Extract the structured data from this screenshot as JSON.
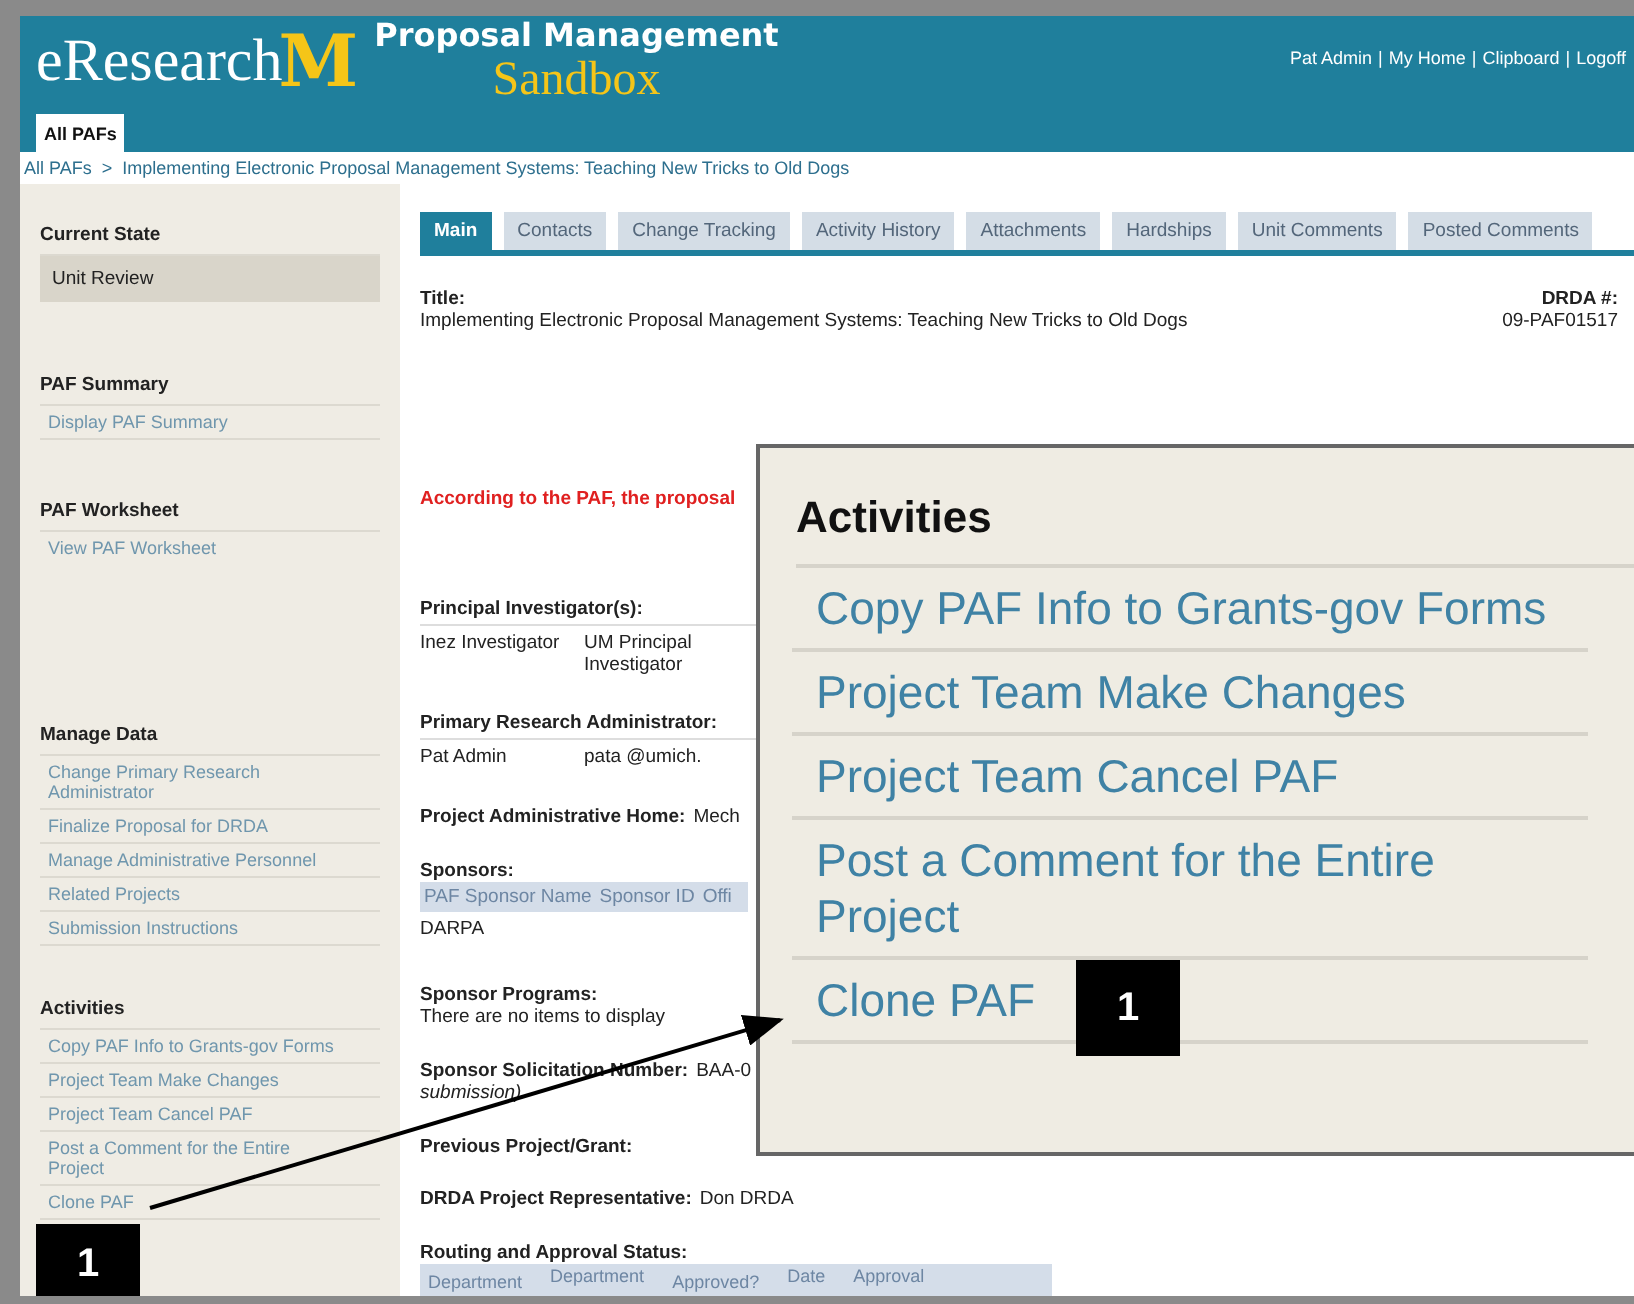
{
  "header": {
    "brand": "eResearch",
    "logo_letter": "M",
    "app_title": "Proposal Management",
    "environment": "Sandbox",
    "user_links": [
      "Pat Admin",
      "My Home",
      "Clipboard",
      "Logoff"
    ],
    "user_link_separator": "|",
    "tabs": [
      {
        "label": "All PAFs",
        "selected": true
      }
    ]
  },
  "breadcrumb": {
    "items": [
      "All PAFs",
      "Implementing Electronic Proposal Management Systems: Teaching New Tricks to Old Dogs"
    ],
    "separator": ">"
  },
  "sidebar": [
    {
      "heading": "Current State",
      "kind": "state",
      "items": [
        "Unit Review"
      ]
    },
    {
      "heading": "PAF Summary",
      "kind": "links",
      "items": [
        "Display PAF Summary"
      ]
    },
    {
      "heading": "PAF Worksheet",
      "kind": "plain",
      "items": [
        "View PAF Worksheet"
      ]
    },
    {
      "heading": "Manage Data",
      "kind": "links",
      "items": [
        "Change Primary Research Administrator",
        "Finalize Proposal for DRDA",
        "Manage Administrative Personnel",
        "Related Projects",
        "Submission Instructions"
      ]
    },
    {
      "heading": "Activities",
      "kind": "links",
      "items": [
        "Copy PAF Info to Grants-gov Forms",
        "Project Team Make Changes",
        "Project Team Cancel PAF",
        "Post a Comment for the Entire Project",
        "Clone PAF"
      ]
    }
  ],
  "tabs": [
    {
      "label": "Main",
      "selected": true
    },
    {
      "label": "Contacts",
      "selected": false
    },
    {
      "label": "Change Tracking",
      "selected": false
    },
    {
      "label": "Activity History",
      "selected": false
    },
    {
      "label": "Attachments",
      "selected": false
    },
    {
      "label": "Hardships",
      "selected": false
    },
    {
      "label": "Unit Comments",
      "selected": false
    },
    {
      "label": "Posted Comments",
      "selected": false
    }
  ],
  "main": {
    "title_label": "Title:",
    "title": "Implementing Electronic Proposal Management Systems: Teaching New Tricks to Old Dogs",
    "drda_label": "DRDA #:",
    "drda_number": "09-PAF01517",
    "notice": "According to the PAF, the proposal",
    "pi": {
      "heading": "Principal Investigator(s):",
      "cells": [
        "Inez Investigator",
        "UM Principal Investigator"
      ]
    },
    "admin": {
      "heading": "Primary Research Administrator:",
      "cells": [
        "Pat Admin",
        "pata @umich."
      ]
    },
    "home": {
      "label": "Project Administrative Home:",
      "value": "Mech"
    },
    "sponsors": {
      "heading": "Sponsors:",
      "columns": [
        "PAF Sponsor Name",
        "Sponsor ID",
        "Offi"
      ],
      "rows": [
        [
          "DARPA"
        ]
      ]
    },
    "programs": {
      "heading": "Sponsor Programs:",
      "value": "There are no items to display"
    },
    "solicitation": {
      "label": "Sponsor Solicitation Number:",
      "value": "BAA-0",
      "note": "submission)"
    },
    "previous": {
      "label": "Previous Project/Grant:"
    },
    "representative": {
      "label": "DRDA Project Representative:",
      "value": "Don DRDA"
    },
    "routing": {
      "heading": "Routing and Approval Status:",
      "columns": [
        "Department",
        "Department",
        "Approved?",
        "Date",
        "Approval"
      ]
    }
  },
  "popup": {
    "heading": "Activities",
    "items": [
      "Copy PAF Info to Grants-gov Forms",
      "Project Team Make Changes",
      "Project Team Cancel PAF",
      "Post a Comment for the Entire Project",
      "Clone PAF"
    ]
  },
  "callouts": [
    {
      "label": "1"
    },
    {
      "label": "1"
    }
  ]
}
